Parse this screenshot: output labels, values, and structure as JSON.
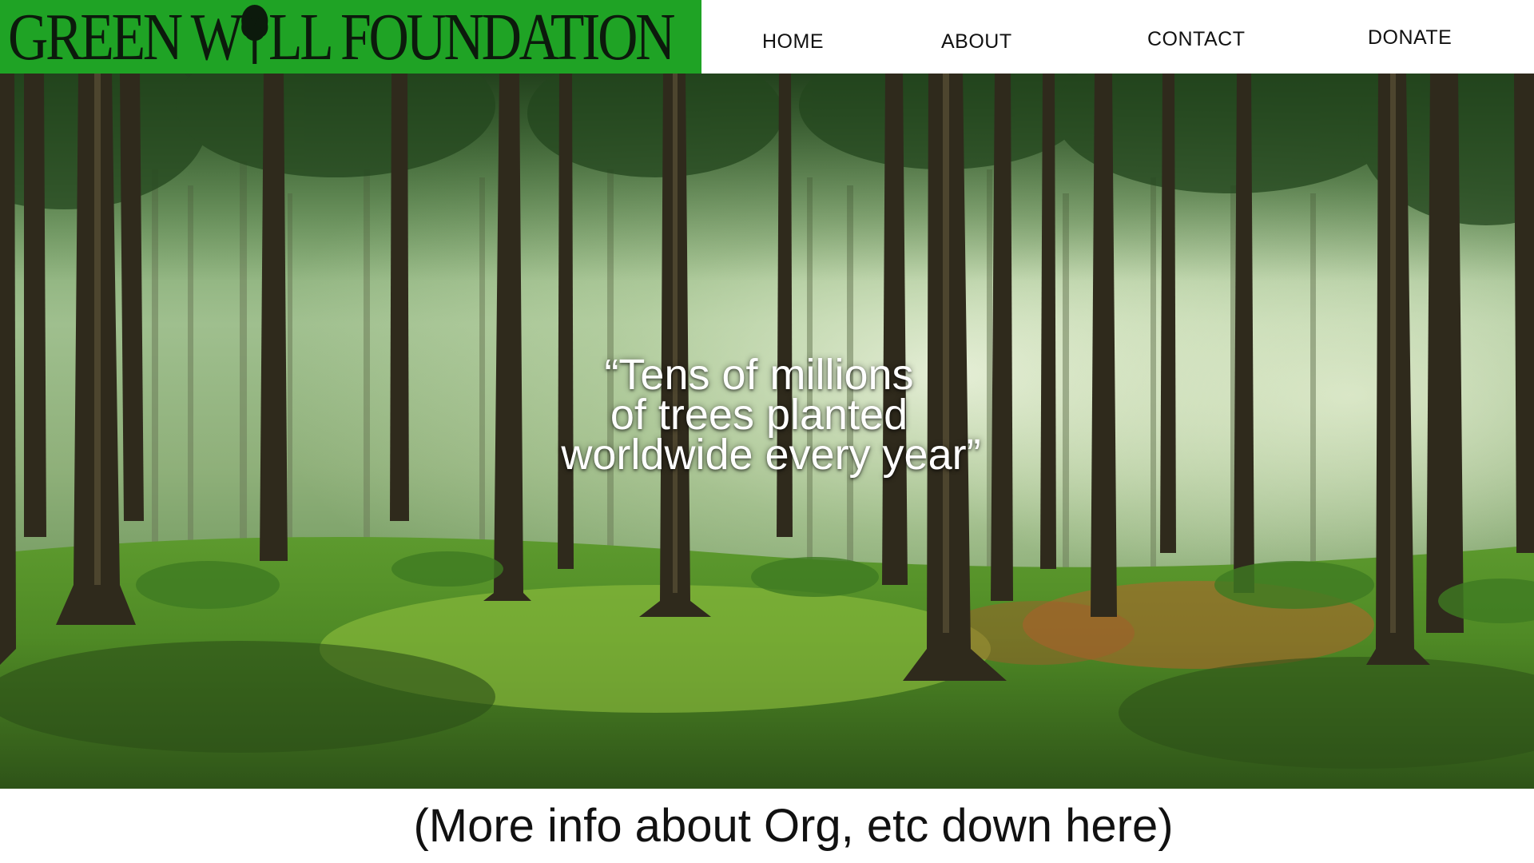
{
  "header": {
    "logo_text_before": "GREEN W",
    "logo_text_after": "LL FOUNDATION",
    "logo_icon": "tree-icon",
    "logo_bg_color": "#1fa325"
  },
  "nav": {
    "items": [
      {
        "label": "HOME"
      },
      {
        "label": "ABOUT"
      },
      {
        "label": "CONTACT"
      },
      {
        "label": "DONATE"
      }
    ]
  },
  "hero": {
    "background": "forest-photo",
    "quote_lines": [
      "“Tens of millions",
      "of trees planted",
      "worldwide every year”"
    ]
  },
  "footer": {
    "more_info": "(More info about Org, etc down here)"
  }
}
